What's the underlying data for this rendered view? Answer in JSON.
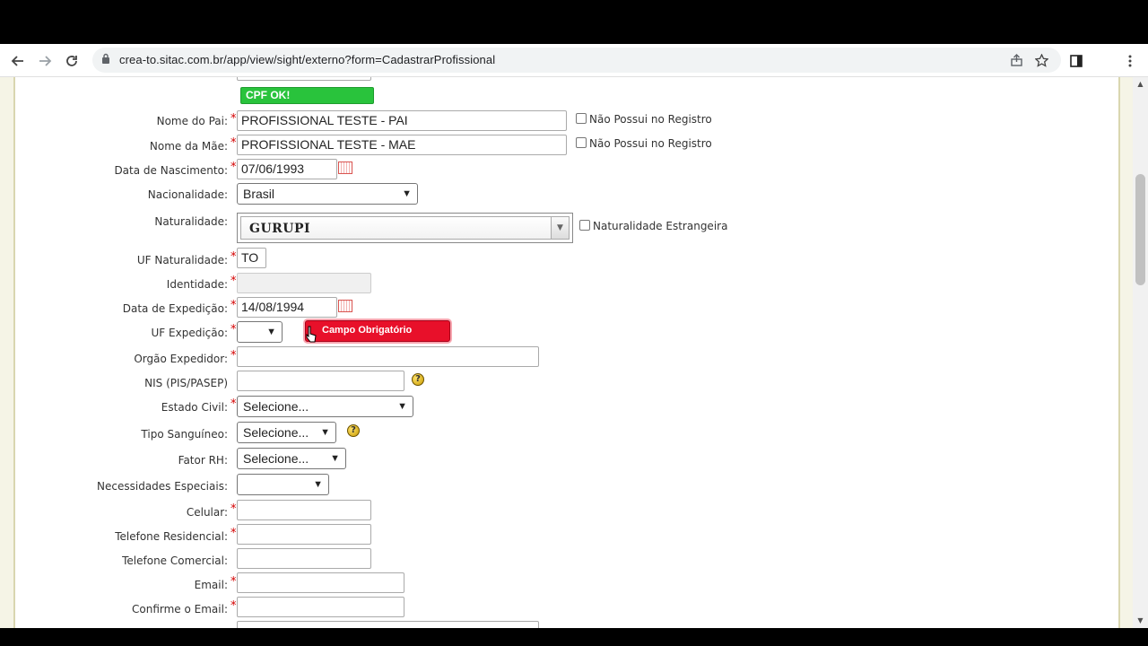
{
  "browser": {
    "url": "crea-to.sitac.com.br/app/view/sight/externo?form=CadastrarProfissional",
    "icons": [
      "back-icon",
      "forward-icon",
      "reload-icon",
      "lock-icon",
      "share-icon",
      "star-icon",
      "sidepanel-icon",
      "menu-icon"
    ]
  },
  "form": {
    "cpf_status": "CPF OK!",
    "nome_pai": {
      "label": "Nome do Pai:",
      "value": "PROFISSIONAL TESTE - PAI",
      "checkbox": "Não Possui no Registro"
    },
    "nome_mae": {
      "label": "Nome da Mãe:",
      "value": "PROFISSIONAL TESTE - MAE",
      "checkbox": "Não Possui no Registro"
    },
    "data_nascimento": {
      "label": "Data de Nascimento:",
      "value": "07/06/1993"
    },
    "nacionalidade": {
      "label": "Nacionalidade:",
      "value": "Brasil"
    },
    "naturalidade": {
      "label": "Naturalidade:",
      "value": "GURUPI",
      "checkbox": "Naturalidade Estrangeira"
    },
    "uf_naturalidade": {
      "label": "UF Naturalidade:",
      "value": "TO"
    },
    "identidade": {
      "label": "Identidade:",
      "value": ""
    },
    "data_expedicao": {
      "label": "Data de Expedição:",
      "value": "14/08/1994"
    },
    "uf_expedicao": {
      "label": "UF Expedição:",
      "value": "",
      "error": "Campo Obrigatório"
    },
    "orgao_expedidor": {
      "label": "Orgão Expedidor:",
      "value": ""
    },
    "nis": {
      "label": "NIS (PIS/PASEP)",
      "value": ""
    },
    "estado_civil": {
      "label": "Estado Civil:",
      "value": "Selecione..."
    },
    "tipo_sanguineo": {
      "label": "Tipo Sanguíneo:",
      "value": "Selecione..."
    },
    "fator_rh": {
      "label": "Fator RH:",
      "value": "Selecione..."
    },
    "necessidades_especiais": {
      "label": "Necessidades Especiais:",
      "value": ""
    },
    "celular": {
      "label": "Celular:",
      "value": ""
    },
    "telefone_residencial": {
      "label": "Telefone Residencial:",
      "value": ""
    },
    "telefone_comercial": {
      "label": "Telefone Comercial:",
      "value": ""
    },
    "email": {
      "label": "Email:",
      "value": ""
    },
    "confirme_email": {
      "label": "Confirme o Email:",
      "value": ""
    },
    "required_mark": "*",
    "help_glyph": "?"
  },
  "colors": {
    "ok_green": "#29c33c",
    "error_red": "#e8102a",
    "required_red": "#d40000"
  }
}
